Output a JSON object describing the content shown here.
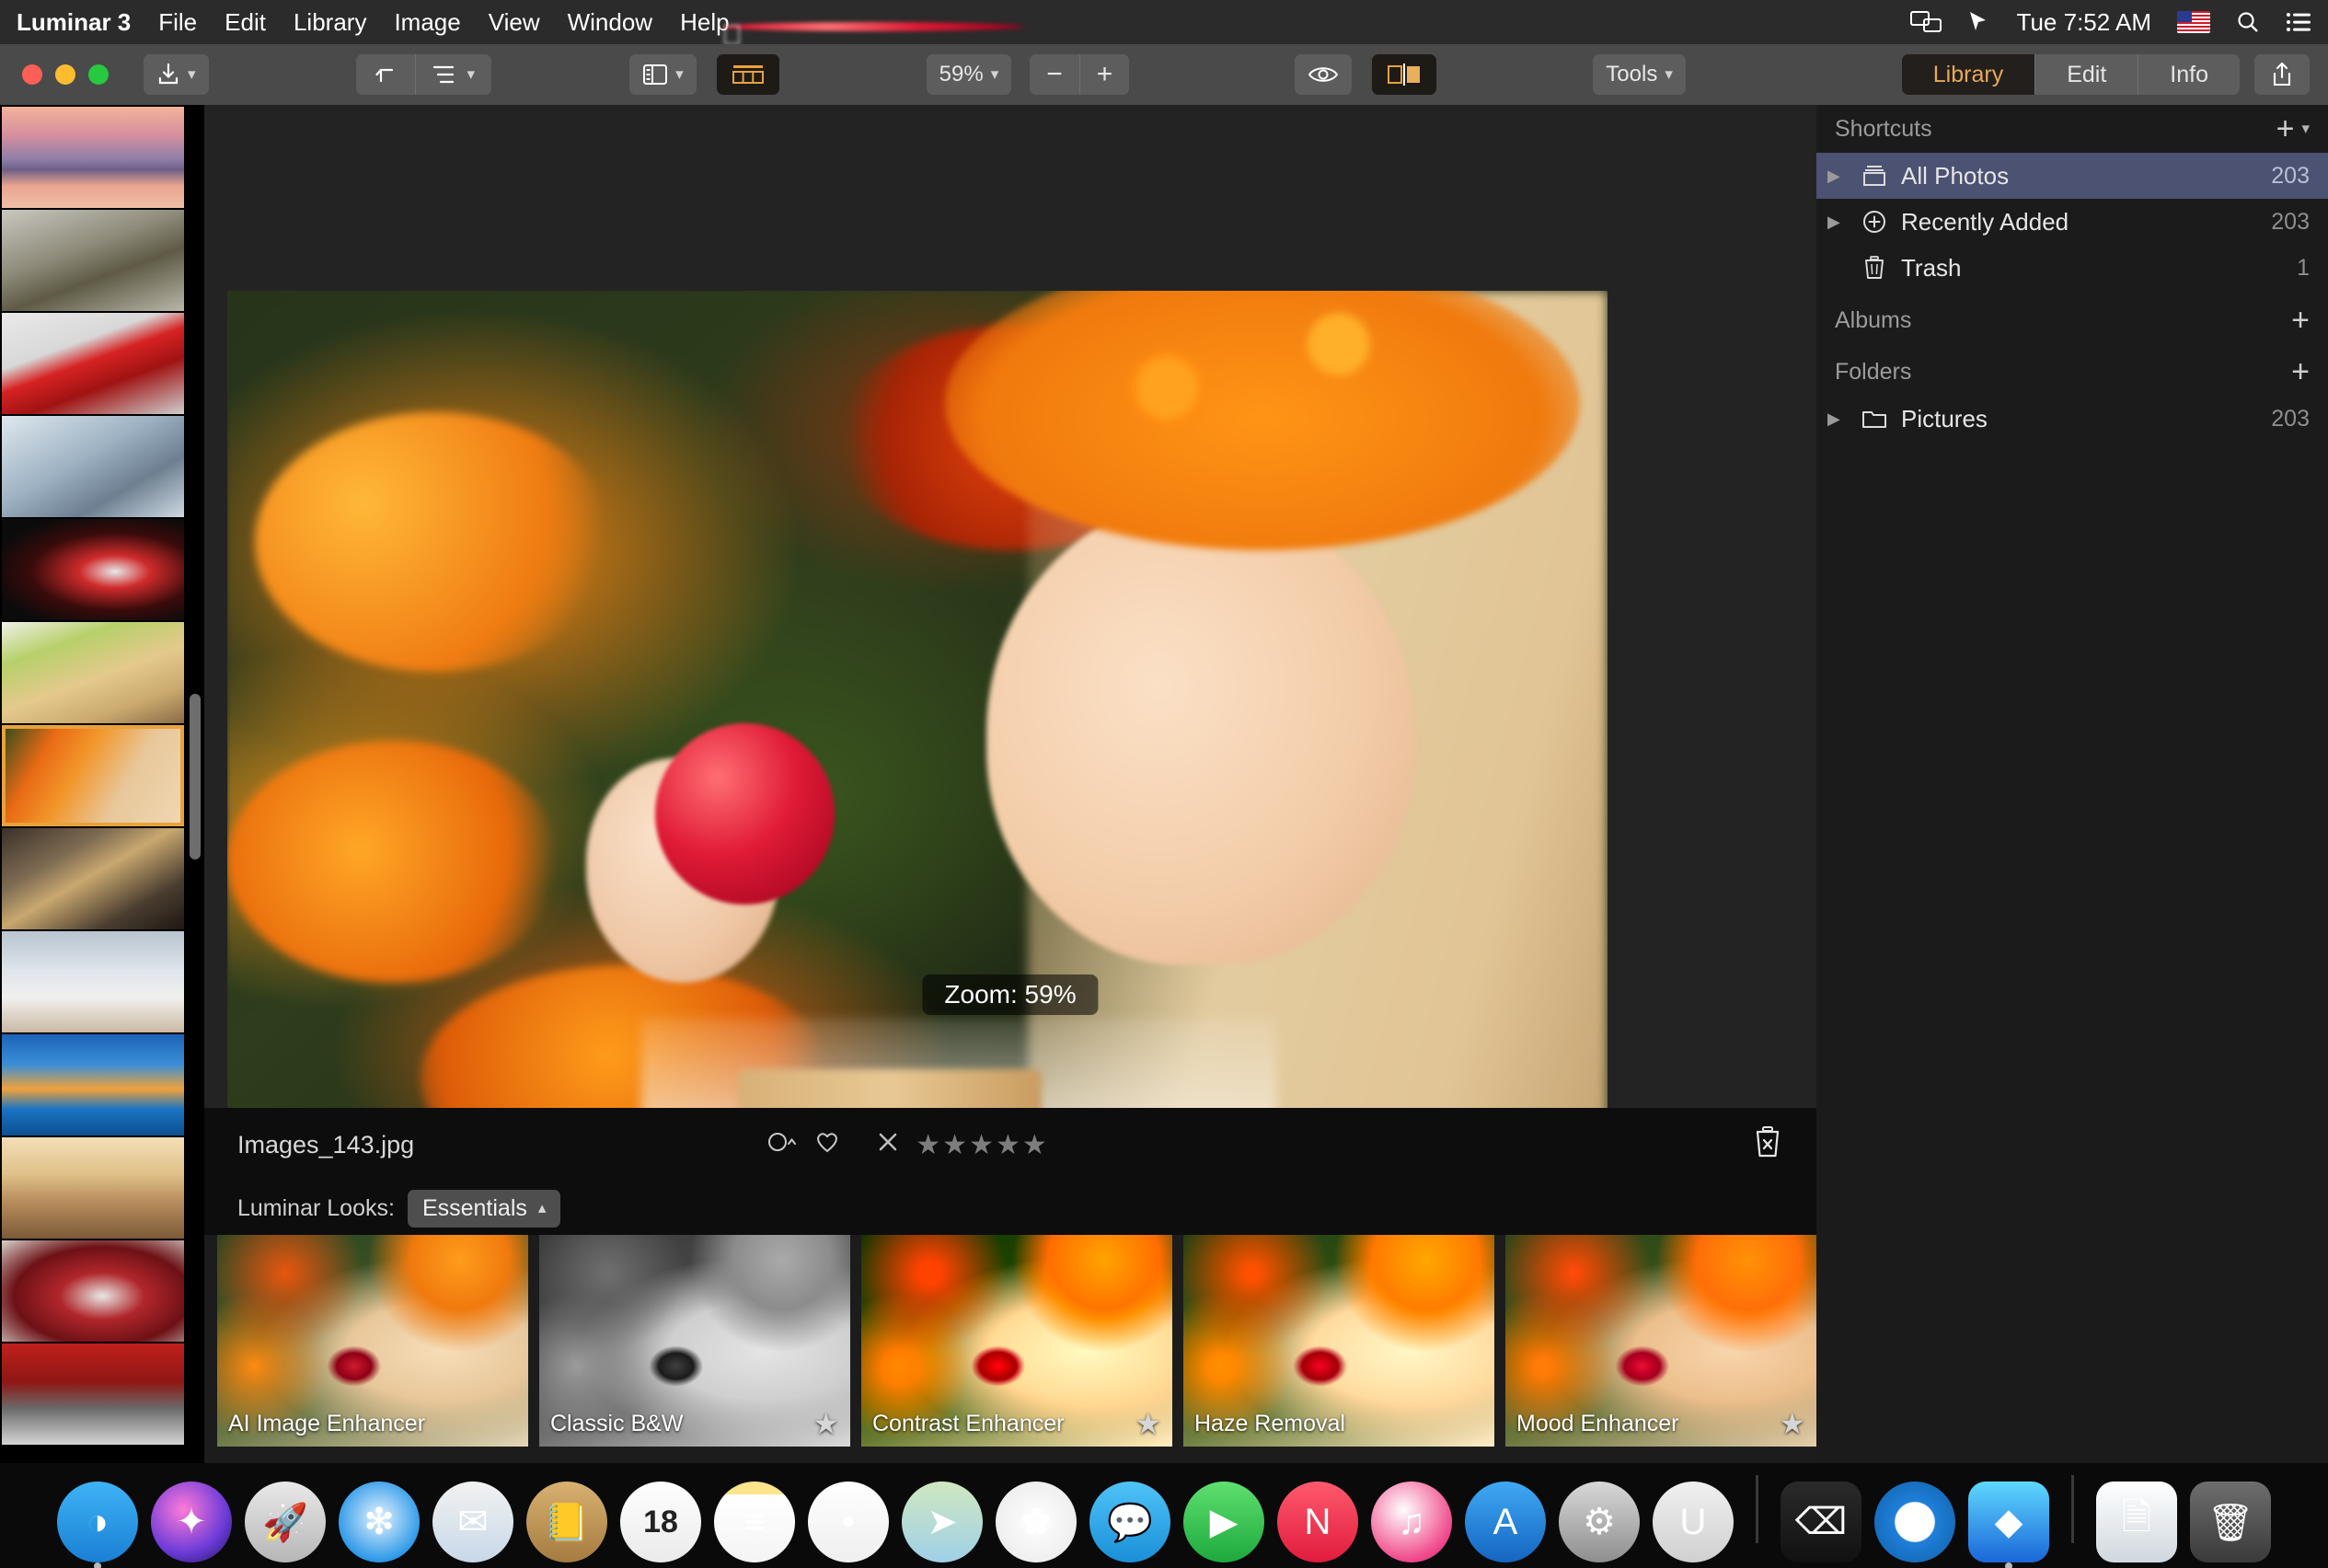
{
  "menubar": {
    "apple_icon": "apple-icon",
    "app_name": "Luminar 3",
    "items": [
      "File",
      "Edit",
      "Library",
      "Image",
      "View",
      "Window",
      "Help"
    ],
    "status": {
      "screen_mirror_icon": "screen-mirroring-icon",
      "cursor_icon": "pointer-icon",
      "clock": "Tue 7:52 AM",
      "flag_icon": "us-flag-icon",
      "search_icon": "search-icon",
      "control_center_icon": "list-menu-icon"
    }
  },
  "toolbar": {
    "export_label": "export-icon",
    "undo_label": "undo-icon",
    "list_label": "list-view-icon",
    "sidepanel_label": "side-panel-icon",
    "filmstrip_label": "filmstrip-icon",
    "zoom_value": "59%",
    "zoom_out": "−",
    "zoom_in": "+",
    "preview_label": "eye-icon",
    "compare_label": "compare-icon",
    "tools_label": "Tools",
    "tabs": [
      {
        "label": "Library",
        "active": true
      },
      {
        "label": "Edit",
        "active": false
      },
      {
        "label": "Info",
        "active": false
      }
    ],
    "share_label": "share-icon"
  },
  "canvas": {
    "zoom_badge": "Zoom: 59%"
  },
  "filebar": {
    "filename": "Images_143.jpg",
    "color_label_icon": "color-label-icon",
    "favorite_icon": "heart-icon",
    "reject_icon": "reject-x-icon",
    "stars": [
      "★",
      "★",
      "★",
      "★",
      "★"
    ],
    "star_rating": 0,
    "delete_icon": "trash-x-icon"
  },
  "looks": {
    "title": "Luminar Looks:",
    "category": "Essentials",
    "category_chevron": "˄",
    "items": [
      {
        "label": "AI Image Enhancer",
        "starred": false,
        "style": "base"
      },
      {
        "label": "Classic B&W",
        "starred": true,
        "style": "bw"
      },
      {
        "label": "Contrast Enhancer",
        "starred": true,
        "style": "contrastfx"
      },
      {
        "label": "Haze Removal",
        "starred": false,
        "style": "hazefx"
      },
      {
        "label": "Mood Enhancer",
        "starred": true,
        "style": "moodfx"
      }
    ]
  },
  "sidebar": {
    "shortcuts_title": "Shortcuts",
    "shortcuts_add": "+",
    "shortcuts": [
      {
        "label": "All Photos",
        "count": "203",
        "icon": "photos-stack-icon",
        "selected": true,
        "expandable": true
      },
      {
        "label": "Recently Added",
        "count": "203",
        "icon": "plus-circle-icon",
        "selected": false,
        "expandable": true
      },
      {
        "label": "Trash",
        "count": "1",
        "icon": "trash-icon",
        "selected": false,
        "expandable": false
      }
    ],
    "albums_title": "Albums",
    "albums_add": "+",
    "folders_title": "Folders",
    "folders_add": "+",
    "folders": [
      {
        "label": "Pictures",
        "count": "203",
        "icon": "folder-icon",
        "expandable": true
      }
    ]
  },
  "filmstrip": {
    "selected_index": 6,
    "thumbs": [
      {
        "name": "sunset-lake-thumb",
        "css": "linear-gradient(180deg,#f2b39a 0%,#d68f9e 28%,#8e7fa8 52%,#6d5f86 62%,#e8a48e 78%,#f0c0a6 100%)"
      },
      {
        "name": "creature-thumb",
        "css": "linear-gradient(160deg,#c9c7c0 0%,#8e8b7a 40%,#5e5a45 62%,#b9b6a8 100%)"
      },
      {
        "name": "red-sports-car-thumb",
        "css": "linear-gradient(160deg,#e9e9e9 0%,#d8d8d8 34%,#d62222 48%,#a01313 66%,#cfcfcf 100%)"
      },
      {
        "name": "machinery-thumb",
        "css": "linear-gradient(150deg,#dfe8ee 0%,#9fb3c4 42%,#6d7f90 70%,#cdd9e2 100%)"
      },
      {
        "name": "red-shoe-thumb",
        "css": "radial-gradient(ellipse at 62% 52%, #e8e8e8 0%, #cf2b2b 22%, #3a0b0b 52%, #0b0b0b 80%)"
      },
      {
        "name": "food-plate-thumb",
        "css": "linear-gradient(160deg,#eef1e6 0%,#b7d06a 26%,#e4c98c 54%,#caa96e 78%,#8a6b47 100%)"
      },
      {
        "name": "berry-girl-thumb",
        "css": "linear-gradient(120deg,#2d4a1c 0%,#e96a14 24%,#f2962a 42%,#e8c79a 66%,#f0d8b4 100%)"
      },
      {
        "name": "interior-lounge-thumb",
        "css": "linear-gradient(150deg,#3b3128 0%,#7d6a52 30%,#c9a86f 48%,#4a3d30 76%,#1d1812 100%)"
      },
      {
        "name": "sailboats-thumb",
        "css": "linear-gradient(180deg,#b9c4cf 0%,#dfe6ec 40%,#f0f0ee 66%,#cbb9a4 100%)"
      },
      {
        "name": "beach-resort-thumb",
        "css": "linear-gradient(180deg,#1d63b8 0%,#3a8fd6 30%,#f0a23a 54%,#1a74c4 74%,#0c4f90 100%)"
      },
      {
        "name": "sunset-model-thumb",
        "css": "linear-gradient(180deg,#f2dfb8 0%,#e0c189 36%,#b98f5e 62%,#7d5a38 100%)"
      },
      {
        "name": "cherries-thumb",
        "css": "radial-gradient(ellipse at 55% 55%, #e8e8e4 0%, #b0262b 30%, #6d1116 62%, #d7d2cb 100%)"
      },
      {
        "name": "red-garage-thumb",
        "css": "linear-gradient(180deg,#c0201c 0%,#8f1714 38%,#6a6a6a 64%,#d6d6d6 100%)"
      }
    ]
  },
  "dock": {
    "items": [
      {
        "name": "finder",
        "glyph": "◑",
        "bg": "linear-gradient(180deg,#3eb3f6,#1a7fd4)",
        "running": true
      },
      {
        "name": "siri",
        "glyph": "✦",
        "bg": "radial-gradient(circle at 40% 35%,#ff7ad9,#6b3bd8 60%,#1b1150)",
        "running": false
      },
      {
        "name": "launchpad",
        "glyph": "🚀",
        "bg": "linear-gradient(180deg,#e9e9e9,#b6b6b6)",
        "running": false
      },
      {
        "name": "safari",
        "glyph": "❇",
        "bg": "radial-gradient(circle at 50% 45%,#e8f4ff,#2f9ae8 70%,#1767b8)",
        "running": false
      },
      {
        "name": "mail",
        "glyph": "✉",
        "bg": "linear-gradient(180deg,#f2f2f2,#c8d8e8)",
        "running": false
      },
      {
        "name": "contacts",
        "glyph": "📒",
        "bg": "linear-gradient(180deg,#d8b171,#a57b3f)",
        "running": false
      },
      {
        "name": "calendar",
        "glyph": "18",
        "bg": "linear-gradient(180deg,#ffffff,#eaeaea)",
        "running": false
      },
      {
        "name": "notes",
        "glyph": "≡",
        "bg": "linear-gradient(180deg,#fbe48a 0%,#fbe48a 16%,#ffffff 16%,#f4f4f4 100%)",
        "running": false
      },
      {
        "name": "reminders",
        "glyph": "•",
        "bg": "linear-gradient(180deg,#ffffff,#efefef)",
        "running": false
      },
      {
        "name": "maps",
        "glyph": "➤",
        "bg": "linear-gradient(180deg,#cfe8c0,#9fd0e8)",
        "running": false
      },
      {
        "name": "photos",
        "glyph": "✿",
        "bg": "radial-gradient(circle at 50% 50%,#ffffff,#e8e8e8)",
        "running": false
      },
      {
        "name": "messages",
        "glyph": "💬",
        "bg": "linear-gradient(180deg,#4fc3f7,#1a8fd8)",
        "running": false
      },
      {
        "name": "facetime",
        "glyph": "▶",
        "bg": "linear-gradient(180deg,#5ee070,#1ea83c)",
        "running": false
      },
      {
        "name": "news",
        "glyph": "N",
        "bg": "linear-gradient(180deg,#ff5a6e,#e01b3c)",
        "running": false
      },
      {
        "name": "itunes",
        "glyph": "♫",
        "bg": "radial-gradient(circle at 40% 35%,#ffffff,#f04a8a 70%,#b01e7a)",
        "running": false
      },
      {
        "name": "app-store",
        "glyph": "A",
        "bg": "linear-gradient(180deg,#3fa9f5,#1565c0)",
        "running": false
      },
      {
        "name": "system-preferences",
        "glyph": "⚙",
        "bg": "linear-gradient(180deg,#d8d8d8,#8e8e8e)",
        "running": false
      },
      {
        "name": "magnet",
        "glyph": "U",
        "bg": "linear-gradient(180deg,#f0f0f0,#d0d0d0)",
        "running": false
      },
      {
        "name": "terminal",
        "glyph": "⌫",
        "bg": "linear-gradient(180deg,#2a2a2a,#111)",
        "running": false
      },
      {
        "name": "1password",
        "glyph": "ⓘ",
        "bg": "radial-gradient(circle at 50% 50%,#ffffff 34%,#1f7fd8 36%,#0e5fa8)",
        "running": false
      },
      {
        "name": "luminar",
        "glyph": "◆",
        "bg": "linear-gradient(180deg,#5fd8ff,#1a66d8)",
        "running": true
      },
      {
        "name": "downloads-stack",
        "glyph": "🗎",
        "bg": "linear-gradient(180deg,#ffffff,#cfd8df)",
        "running": false
      },
      {
        "name": "trash",
        "glyph": "🗑",
        "bg": "linear-gradient(180deg,#6e6e6e,#3a3a3a)",
        "running": false
      }
    ]
  }
}
